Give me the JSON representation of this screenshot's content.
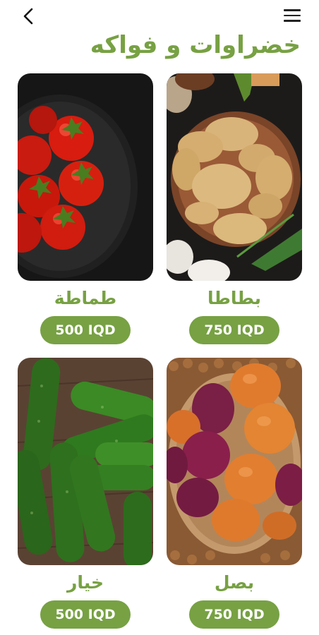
{
  "header": {
    "title": "خضراوات و فواكه",
    "back_icon": "arrow-back-icon",
    "menu_icon": "menu-icon"
  },
  "accent_color": "#77a143",
  "products": [
    {
      "name": "بطاطا",
      "price": "750 IQD",
      "image": "potatoes"
    },
    {
      "name": "طماطة",
      "price": "500 IQD",
      "image": "tomatoes"
    },
    {
      "name": "بصل",
      "price": "750 IQD",
      "image": "onions"
    },
    {
      "name": "خيار",
      "price": "500 IQD",
      "image": "cucumbers"
    }
  ]
}
